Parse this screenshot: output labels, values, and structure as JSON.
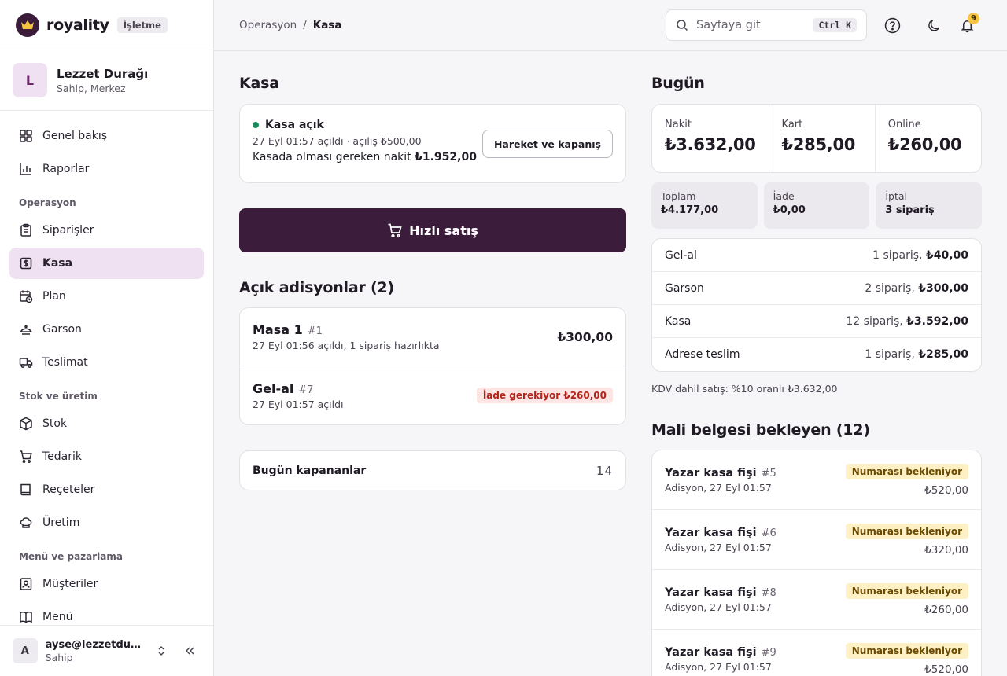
{
  "brand": {
    "name": "royality",
    "badge": "İşletme"
  },
  "org": {
    "initial": "L",
    "name": "Lezzet Durağı",
    "role": "Sahip, Merkez"
  },
  "nav": {
    "top": [
      {
        "label": "Genel bakış",
        "icon": "grid-icon"
      },
      {
        "label": "Raporlar",
        "icon": "bar-chart-icon"
      }
    ],
    "sections": [
      {
        "title": "Operasyon",
        "items": [
          {
            "label": "Siparişler",
            "icon": "clipboard-icon",
            "active": false
          },
          {
            "label": "Kasa",
            "icon": "cash-register-icon",
            "active": true
          },
          {
            "label": "Plan",
            "icon": "calendar-clock-icon",
            "active": false
          },
          {
            "label": "Garson",
            "icon": "cloche-icon",
            "active": false
          },
          {
            "label": "Teslimat",
            "icon": "truck-icon",
            "active": false
          }
        ]
      },
      {
        "title": "Stok ve üretim",
        "items": [
          {
            "label": "Stok",
            "icon": "box-icon",
            "active": false
          },
          {
            "label": "Tedarik",
            "icon": "cart-icon",
            "active": false
          },
          {
            "label": "Reçeteler",
            "icon": "book-icon",
            "active": false
          },
          {
            "label": "Üretim",
            "icon": "chef-hat-icon",
            "active": false
          }
        ]
      },
      {
        "title": "Menü ve pazarlama",
        "items": [
          {
            "label": "Müşteriler",
            "icon": "contact-icon",
            "active": false
          },
          {
            "label": "Menü",
            "icon": "menu-book-icon",
            "active": false
          }
        ]
      }
    ]
  },
  "user": {
    "initial": "A",
    "email": "ayse@lezzetduragi.com",
    "role": "Sahip"
  },
  "topbar": {
    "breadcrumb_parent": "Operasyon",
    "breadcrumb_sep": "/",
    "breadcrumb_current": "Kasa",
    "search_placeholder": "Sayfaya git",
    "search_shortcut": "Ctrl K",
    "notification_count": "9"
  },
  "kasa": {
    "title": "Kasa",
    "status": "Kasa açık",
    "meta": "27 Eyl 01:57 açıldı · açılış ₺500,00",
    "expected_label": "Kasada olması gereken nakit",
    "expected_value": "₺1.952,00",
    "action_label": "Hareket ve kapanış",
    "quick_sale_label": "Hızlı satış"
  },
  "open_tabs": {
    "title": "Açık adisyonlar (2)",
    "items": [
      {
        "name": "Masa 1",
        "num": "#1",
        "sub": "27 Eyl 01:56 açıldı, 1 sipariş hazırlıkta",
        "amount": "₺300,00",
        "badge": ""
      },
      {
        "name": "Gel-al",
        "num": "#7",
        "sub": "27 Eyl 01:57 açıldı",
        "amount": "",
        "badge": "İade gerekiyor ₺260,00"
      }
    ]
  },
  "closed_today": {
    "label": "Bugün kapananlar",
    "count": "14"
  },
  "today": {
    "title": "Bugün",
    "totals": [
      {
        "label": "Nakit",
        "value": "₺3.632,00"
      },
      {
        "label": "Kart",
        "value": "₺285,00"
      },
      {
        "label": "Online",
        "value": "₺260,00"
      }
    ],
    "summary": [
      {
        "label": "Toplam",
        "value": "₺4.177,00"
      },
      {
        "label": "İade",
        "value": "₺0,00"
      },
      {
        "label": "İptal",
        "value": "3 sipariş"
      }
    ],
    "channels": [
      {
        "name": "Gel-al",
        "count": "1 sipariş,",
        "amount": "₺40,00"
      },
      {
        "name": "Garson",
        "count": "2 sipariş,",
        "amount": "₺300,00"
      },
      {
        "name": "Kasa",
        "count": "12 sipariş,",
        "amount": "₺3.592,00"
      },
      {
        "name": "Adrese teslim",
        "count": "1 sipariş,",
        "amount": "₺285,00"
      }
    ],
    "kdv_note": "KDV dahil satış: %10 oranlı ₺3.632,00"
  },
  "fiscal": {
    "title": "Mali belgesi bekleyen (12)",
    "items": [
      {
        "name": "Yazar kasa fişi",
        "num": "#5",
        "sub": "Adisyon, 27 Eyl 01:57",
        "badge": "Numarası bekleniyor",
        "amount": "₺520,00"
      },
      {
        "name": "Yazar kasa fişi",
        "num": "#6",
        "sub": "Adisyon, 27 Eyl 01:57",
        "badge": "Numarası bekleniyor",
        "amount": "₺320,00"
      },
      {
        "name": "Yazar kasa fişi",
        "num": "#8",
        "sub": "Adisyon, 27 Eyl 01:57",
        "badge": "Numarası bekleniyor",
        "amount": "₺260,00"
      },
      {
        "name": "Yazar kasa fişi",
        "num": "#9",
        "sub": "Adisyon, 27 Eyl 01:57",
        "badge": "Numarası bekleniyor",
        "amount": "₺520,00"
      }
    ]
  },
  "colors": {
    "brand": "#3b1c3b",
    "active_nav": "#efe1f1",
    "status_open": "#1a8a5a",
    "warning_bg": "#fdf0c4",
    "danger_bg": "#fde5e3"
  }
}
